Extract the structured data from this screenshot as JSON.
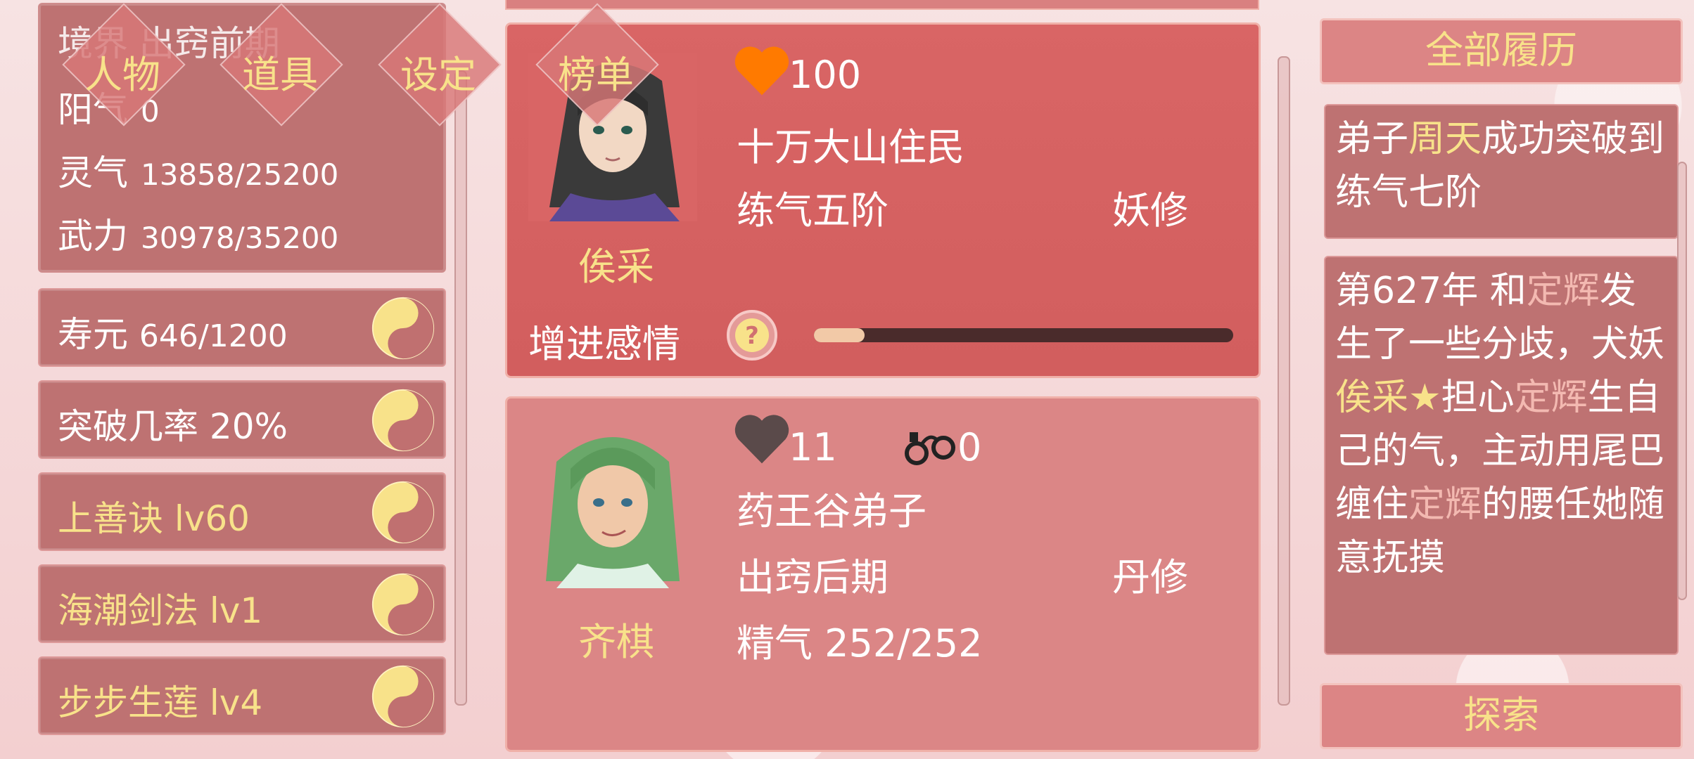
{
  "colors": {
    "gold": "#f8e28a",
    "panel": "#be7272",
    "card_active": "#d96565",
    "card_inactive": "#db8686",
    "heart_orange": "#ff7a00",
    "heart_gray": "#5a4a4a"
  },
  "nav": {
    "tabs": [
      {
        "label": "人物"
      },
      {
        "label": "道具"
      },
      {
        "label": "设定"
      },
      {
        "label": "榜单"
      }
    ]
  },
  "stats": {
    "realm_partial": "境界 出窍前期",
    "yang_label": "阳气",
    "yang_value": "0",
    "lingqi_label": "灵气",
    "lingqi_value": "13858/25200",
    "wuli_label": "武力",
    "wuli_value": "30978/35200"
  },
  "skills": [
    {
      "label": "寿元",
      "value": "646/1200",
      "color": "white",
      "icon": "yin-yang-icon"
    },
    {
      "label": "突破几率",
      "value": "20%",
      "color": "white",
      "icon": "yin-yang-icon"
    },
    {
      "label": "上善诀 lv60",
      "value": "",
      "color": "gold",
      "icon": "yin-yang-icon"
    },
    {
      "label": "海潮剑法 lv1",
      "value": "",
      "color": "gold",
      "icon": "yin-yang-icon"
    },
    {
      "label": "步步生莲 lv4",
      "value": "",
      "color": "gold",
      "icon": "yin-yang-icon"
    }
  ],
  "characters": [
    {
      "name": "俟采",
      "affection": "100",
      "origin": "十万大山住民",
      "realm": "练气五阶",
      "type": "妖修",
      "action": "增进感情",
      "affection_progress": 0.12,
      "heart_color": "#ff7a00"
    },
    {
      "name": "齐棋",
      "affection": "11",
      "handcuff_value": "0",
      "origin": "药王谷弟子",
      "realm": "出窍后期",
      "type": "丹修",
      "essence": "精气 252/252",
      "heart_color": "#5a4a4a"
    }
  ],
  "log": {
    "header": "全部履历",
    "entry1": {
      "p1": "弟子",
      "name": "周天",
      "p2": "成功突破到练气七阶"
    },
    "entry2": {
      "p1": "第627年 和",
      "n1": "定辉",
      "p2": "发生了一些分歧，犬妖",
      "n2": "俟采",
      "star": "★",
      "p3": "担心",
      "n3": "定辉",
      "p4": "生自己的气，主动用尾巴缠住",
      "n4": "定辉",
      "p5": "的腰任她随意抚摸"
    },
    "explore_button": "探索"
  }
}
